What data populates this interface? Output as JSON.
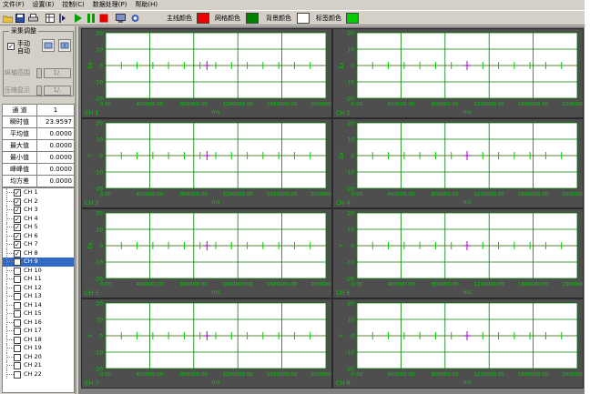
{
  "menu": [
    "文件(F)",
    "设置(E)",
    "控制(C)",
    "数据处理(P)",
    "帮助(H)"
  ],
  "toolbar": {
    "buttons": [
      "open-icon",
      "save-icon",
      "print-icon",
      "table-icon",
      "step-icon",
      "play-icon",
      "pause-icon",
      "stop-icon",
      "monitor-icon",
      "camera-icon"
    ],
    "colors": [
      {
        "label": "主线颜色",
        "color": "#ee0000"
      },
      {
        "label": "网格颜色",
        "color": "#008000"
      },
      {
        "label": "背景颜色",
        "color": "#ffffff"
      },
      {
        "label": "标签颜色",
        "color": "#00cc00"
      }
    ]
  },
  "control_group": {
    "title": "采集调整",
    "checkbox": "手动\n自动",
    "range_label": "纵轴范围",
    "range_value": "1/.",
    "zoom_label": "压缩显示",
    "zoom_value": "1/."
  },
  "stats": {
    "header_key": "通  道",
    "header_value": "1",
    "rows": [
      {
        "label": "瞬时值",
        "value": "23.9597"
      },
      {
        "label": "平均值",
        "value": "0.0000"
      },
      {
        "label": "最大值",
        "value": "0.0000"
      },
      {
        "label": "最小值",
        "value": "0.0000"
      },
      {
        "label": "峰峰值",
        "value": "0.0000"
      },
      {
        "label": "均方差",
        "value": "0.0000"
      }
    ]
  },
  "channels": [
    {
      "label": "CH 1",
      "checked": true,
      "selected": false
    },
    {
      "label": "CH 2",
      "checked": true,
      "selected": false
    },
    {
      "label": "CH 3",
      "checked": true,
      "selected": false
    },
    {
      "label": "CH 4",
      "checked": true,
      "selected": false
    },
    {
      "label": "CH 5",
      "checked": true,
      "selected": false
    },
    {
      "label": "CH 6",
      "checked": true,
      "selected": false
    },
    {
      "label": "CH 7",
      "checked": true,
      "selected": false
    },
    {
      "label": "CH 8",
      "checked": true,
      "selected": false
    },
    {
      "label": "CH 9",
      "checked": false,
      "selected": true
    },
    {
      "label": "CH 10",
      "checked": false,
      "selected": false
    },
    {
      "label": "CH 11",
      "checked": false,
      "selected": false
    },
    {
      "label": "CH 12",
      "checked": false,
      "selected": false
    },
    {
      "label": "CH 13",
      "checked": false,
      "selected": false
    },
    {
      "label": "CH 14",
      "checked": false,
      "selected": false
    },
    {
      "label": "CH 15",
      "checked": false,
      "selected": false
    },
    {
      "label": "CH 16",
      "checked": false,
      "selected": false
    },
    {
      "label": "CH 17",
      "checked": false,
      "selected": false
    },
    {
      "label": "CH 18",
      "checked": false,
      "selected": false
    },
    {
      "label": "CH 19",
      "checked": false,
      "selected": false
    },
    {
      "label": "CH 20",
      "checked": false,
      "selected": false
    },
    {
      "label": "CH 21",
      "checked": false,
      "selected": false
    },
    {
      "label": "CH 22",
      "checked": false,
      "selected": false
    }
  ],
  "chart_data": [
    {
      "type": "line",
      "channel": "CH 1",
      "ylabel": "Ex",
      "xlabel": "ms",
      "yticks": [
        "20",
        "10",
        "0",
        "-10",
        "-20"
      ],
      "xticks": [
        "0.00",
        "400000.00",
        "800000.00",
        "1200000.00",
        "1600000.00",
        "2000000.00"
      ],
      "series": [
        {
          "values": [
            0
          ]
        }
      ]
    },
    {
      "type": "line",
      "channel": "CH 2",
      "ylabel": "Ex",
      "xlabel": "ms",
      "yticks": [
        "20",
        "10",
        "0",
        "-10",
        "-20"
      ],
      "xticks": [
        "0.00",
        "400000.00",
        "800000.00",
        "1200000.00",
        "1600000.00",
        "2000000.00"
      ],
      "series": [
        {
          "values": [
            0
          ]
        }
      ]
    },
    {
      "type": "line",
      "channel": "CH 3",
      "ylabel": "Y",
      "xlabel": "ms",
      "yticks": [
        "20",
        "10",
        "0",
        "-10",
        "-20"
      ],
      "xticks": [
        "0.00",
        "400000.00",
        "800000.00",
        "1200000.00",
        "1600000.00",
        "2000000.00"
      ],
      "series": [
        {
          "values": [
            0
          ]
        }
      ]
    },
    {
      "type": "line",
      "channel": "CH 4",
      "ylabel": "Ex",
      "xlabel": "ms",
      "yticks": [
        "20",
        "10",
        "0",
        "-10",
        "-20"
      ],
      "xticks": [
        "0.00",
        "400000.00",
        "800000.00",
        "1200000.00",
        "1600000.00",
        "2000000.00"
      ],
      "series": [
        {
          "values": [
            0
          ]
        }
      ]
    },
    {
      "type": "line",
      "channel": "CH 5",
      "ylabel": "Ex",
      "xlabel": "ms",
      "yticks": [
        "20",
        "10",
        "0",
        "-10",
        "-20"
      ],
      "xticks": [
        "0.00",
        "400000.00",
        "800000.00",
        "1200000.00",
        "1600000.00",
        "2000000.00"
      ],
      "series": [
        {
          "values": [
            0
          ]
        }
      ]
    },
    {
      "type": "line",
      "channel": "CH 6",
      "ylabel": "Y",
      "xlabel": "ms",
      "yticks": [
        "20",
        "10",
        "0",
        "-10",
        "-20"
      ],
      "xticks": [
        "0.00",
        "400000.00",
        "800000.00",
        "1200000.00",
        "1600000.00",
        "2000000.00"
      ],
      "series": [
        {
          "values": [
            0
          ]
        }
      ]
    },
    {
      "type": "line",
      "channel": "CH 7",
      "ylabel": "Y",
      "xlabel": "ms",
      "yticks": [
        "20",
        "10",
        "0",
        "-10",
        "-20"
      ],
      "xticks": [
        "0.00",
        "400000.00",
        "800000.00",
        "1200000.00",
        "1600000.00",
        "2000000.00"
      ],
      "series": [
        {
          "values": [
            0
          ]
        }
      ]
    },
    {
      "type": "line",
      "channel": "CH 8",
      "ylabel": "Y",
      "xlabel": "ms",
      "yticks": [
        "20",
        "10",
        "0",
        "-10",
        "-20"
      ],
      "xticks": [
        "0.00",
        "400000.00",
        "800000.00",
        "1200000.00",
        "1600000.00",
        "2000000.00"
      ],
      "series": [
        {
          "values": [
            0
          ]
        }
      ]
    }
  ]
}
